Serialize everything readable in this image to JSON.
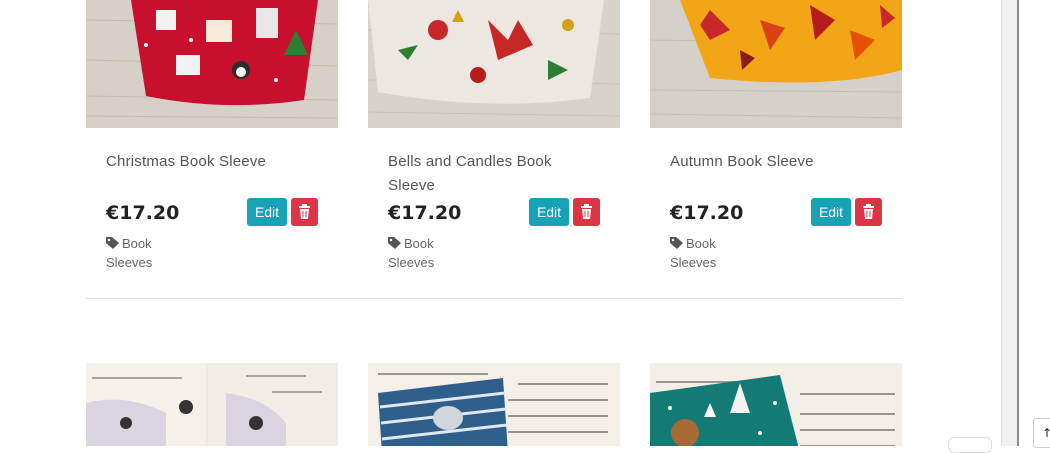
{
  "products": [
    {
      "title": "Christmas Book Sleeve",
      "price": "€17.20",
      "edit_label": "Edit",
      "category": "Book Sleeves",
      "image_icon": "christmas-fabric-image"
    },
    {
      "title": "Bells and Candles Book Sleeve",
      "price": "€17.20",
      "edit_label": "Edit",
      "category": "Book Sleeves",
      "image_icon": "bells-candles-fabric-image"
    },
    {
      "title": "Autumn Book Sleeve",
      "price": "€17.20",
      "edit_label": "Edit",
      "category": "Book Sleeves",
      "image_icon": "autumn-leaves-fabric-image"
    }
  ],
  "colors": {
    "edit": "#17a2b8",
    "delete": "#dc3545",
    "price": "#222222"
  },
  "icons": {
    "delete": "trash-icon",
    "category": "tag-icon"
  }
}
